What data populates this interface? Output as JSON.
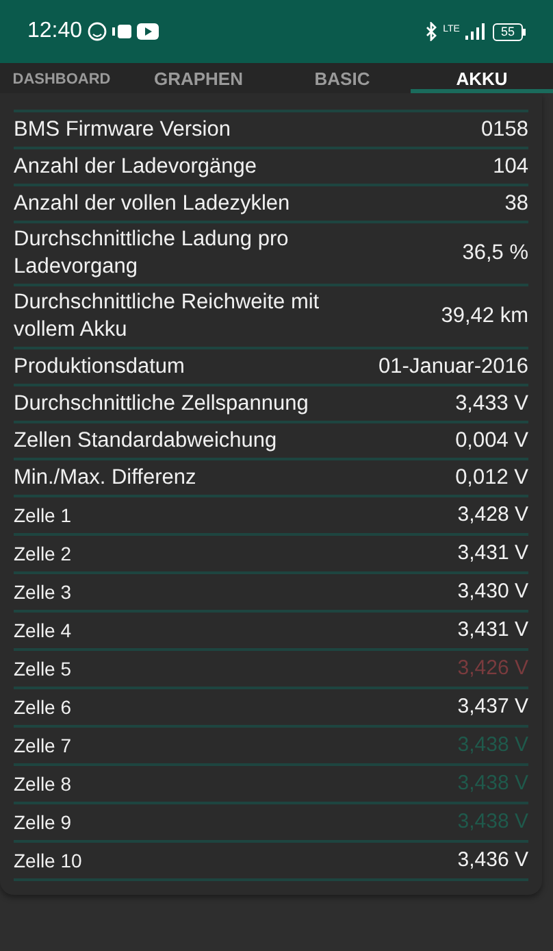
{
  "status_bar": {
    "time": "12:40",
    "battery": "55",
    "network": "LTE"
  },
  "tabs": [
    {
      "label": "DASHBOARD",
      "selected": false
    },
    {
      "label": "GRAPHEN",
      "selected": false
    },
    {
      "label": "BASIC",
      "selected": false
    },
    {
      "label": "AKKU",
      "selected": true
    }
  ],
  "info_rows": [
    {
      "label": "BMS Firmware Version",
      "value": "0158"
    },
    {
      "label": "Anzahl der Ladevorgänge",
      "value": "104"
    },
    {
      "label": "Anzahl der vollen Ladezyklen",
      "value": "38"
    },
    {
      "label": "Durchschnittliche Ladung pro Ladevorgang",
      "value": "36,5 %"
    },
    {
      "label": "Durchschnittliche Reichweite mit vollem Akku",
      "value": "39,42 km"
    },
    {
      "label": "Produktionsdatum",
      "value": "01-Januar-2016"
    },
    {
      "label": "Durchschnittliche Zellspannung",
      "value": "3,433 V"
    },
    {
      "label": "Zellen Standardabweichung",
      "value": "0,004 V"
    },
    {
      "label": "Min./Max. Differenz",
      "value": "0,012 V"
    }
  ],
  "cells": [
    {
      "label": "Zelle 1",
      "value": "3,428 V",
      "color": "#f2f2f2"
    },
    {
      "label": "Zelle 2",
      "value": "3,431 V",
      "color": "#f2f2f2"
    },
    {
      "label": "Zelle 3",
      "value": "3,430 V",
      "color": "#f2f2f2"
    },
    {
      "label": "Zelle 4",
      "value": "3,431 V",
      "color": "#f2f2f2"
    },
    {
      "label": "Zelle 5",
      "value": "3,426 V",
      "color": "#7a3b3e"
    },
    {
      "label": "Zelle 6",
      "value": "3,437 V",
      "color": "#f2f2f2"
    },
    {
      "label": "Zelle 7",
      "value": "3,438 V",
      "color": "#1f5a4c"
    },
    {
      "label": "Zelle 8",
      "value": "3,438 V",
      "color": "#1f5a4c"
    },
    {
      "label": "Zelle 9",
      "value": "3,438 V",
      "color": "#1f5a4c"
    },
    {
      "label": "Zelle 10",
      "value": "3,436 V",
      "color": "#f2f2f2"
    }
  ]
}
